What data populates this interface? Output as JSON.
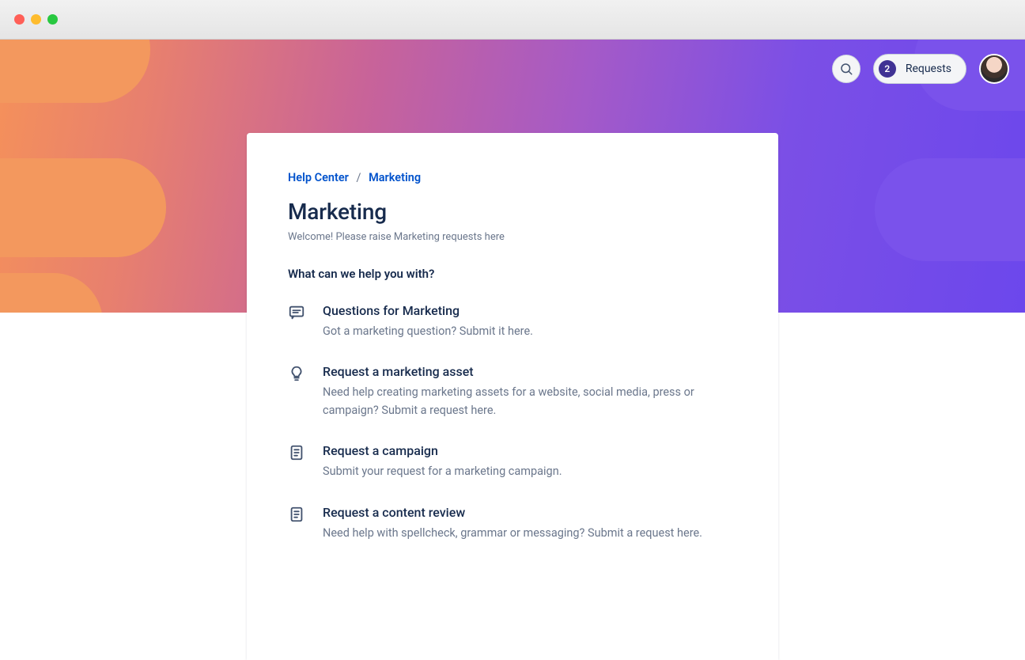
{
  "header": {
    "requests_count": "2",
    "requests_label": "Requests"
  },
  "breadcrumb": {
    "root": "Help Center",
    "current": "Marketing"
  },
  "page": {
    "title": "Marketing",
    "subtitle": "Welcome! Please raise Marketing requests here",
    "section_heading": "What can we help you with?"
  },
  "requests": [
    {
      "icon": "chat-icon",
      "title": "Questions for Marketing",
      "desc": "Got a marketing question? Submit it here."
    },
    {
      "icon": "lightbulb-icon",
      "title": "Request a marketing asset",
      "desc": "Need help creating marketing assets for a website, social media, press or campaign?  Submit a request here."
    },
    {
      "icon": "clipboard-icon",
      "title": "Request a campaign",
      "desc": "Submit your request for a marketing campaign."
    },
    {
      "icon": "clipboard-icon",
      "title": "Request a content review",
      "desc": "Need help with spellcheck, grammar or messaging? Submit a request here."
    }
  ]
}
